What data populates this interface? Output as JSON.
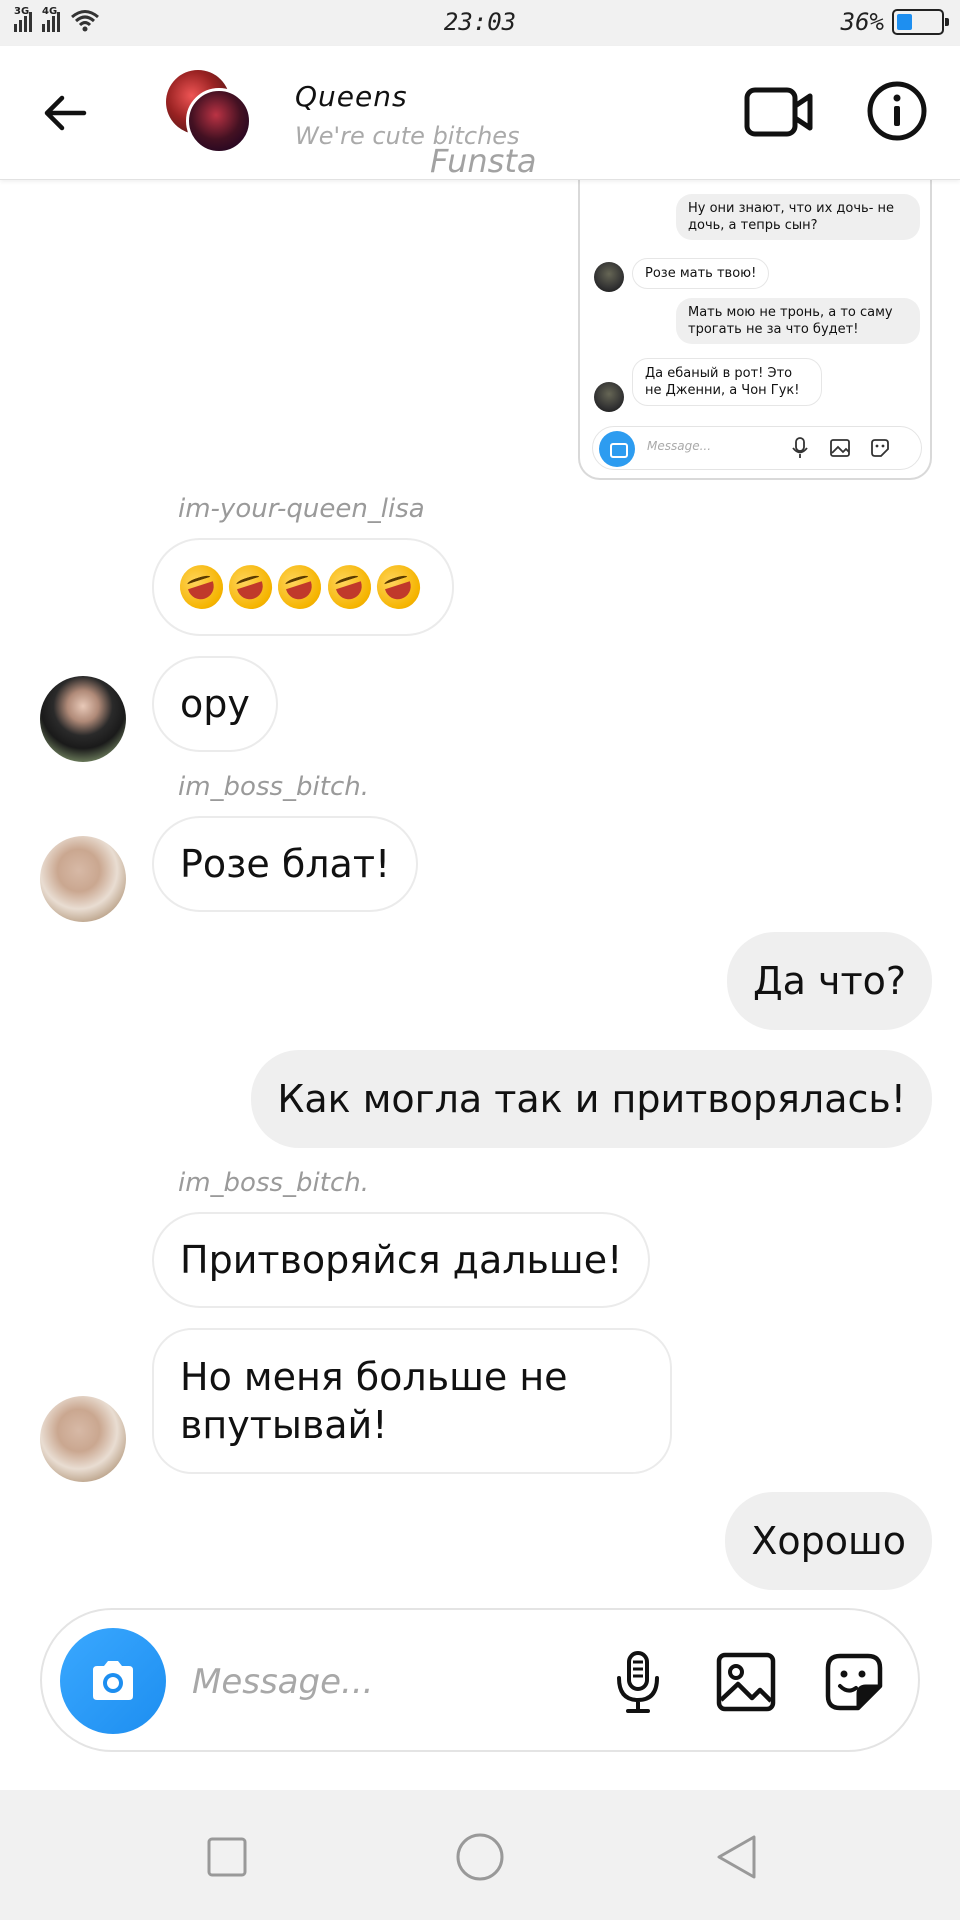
{
  "status_bar": {
    "net1": "3G",
    "net2": "4G",
    "time": "23:03",
    "battery_text": "36%",
    "battery_level": 0.36,
    "icons": [
      "signal-icon",
      "wifi-icon",
      "battery-icon"
    ]
  },
  "header": {
    "title": "Queens",
    "subtitle": "We're cute bitches",
    "watermark": "Funsta",
    "icons": [
      "back-arrow-icon",
      "video-call-icon",
      "info-icon"
    ]
  },
  "embedded": {
    "messages": [
      "Ну они знают, что их дочь- не дочь, а тепрь сын?",
      "Розе мать твою!",
      "Мать мою не тронь, а то саму трогать не за что будет!",
      "Да ебаный в рот! Это не Дженни, а Чон Гук!"
    ],
    "placeholder": "Message..."
  },
  "chat": {
    "sender_lisa": "im-your-queen_lisa",
    "emoji_msg": "🤣🤣🤣🤣🤣",
    "msg_oru": "ору",
    "sender_boss_1": "im_boss_bitch.",
    "msg_roze_blat": "Розе блат!",
    "msg_da_chto": "Да что?",
    "msg_kak_mogla": "Как могла так и притворялась!",
    "sender_boss_2": "im_boss_bitch.",
    "msg_pritvoryaysya": "Притворяйся дальше!",
    "msg_no_menya": "Но меня больше не впутывай!",
    "msg_horosho": "Хорошо"
  },
  "input": {
    "placeholder": "Message...",
    "value": "",
    "icons": [
      "camera-icon",
      "microphone-icon",
      "gallery-icon",
      "sticker-icon"
    ]
  },
  "nav": {
    "icons": [
      "recent-apps-icon",
      "home-icon",
      "back-icon"
    ]
  },
  "colors": {
    "accent": "#1d8ef0",
    "outgoing_bubble": "#efefef",
    "incoming_border": "#ebebeb"
  }
}
